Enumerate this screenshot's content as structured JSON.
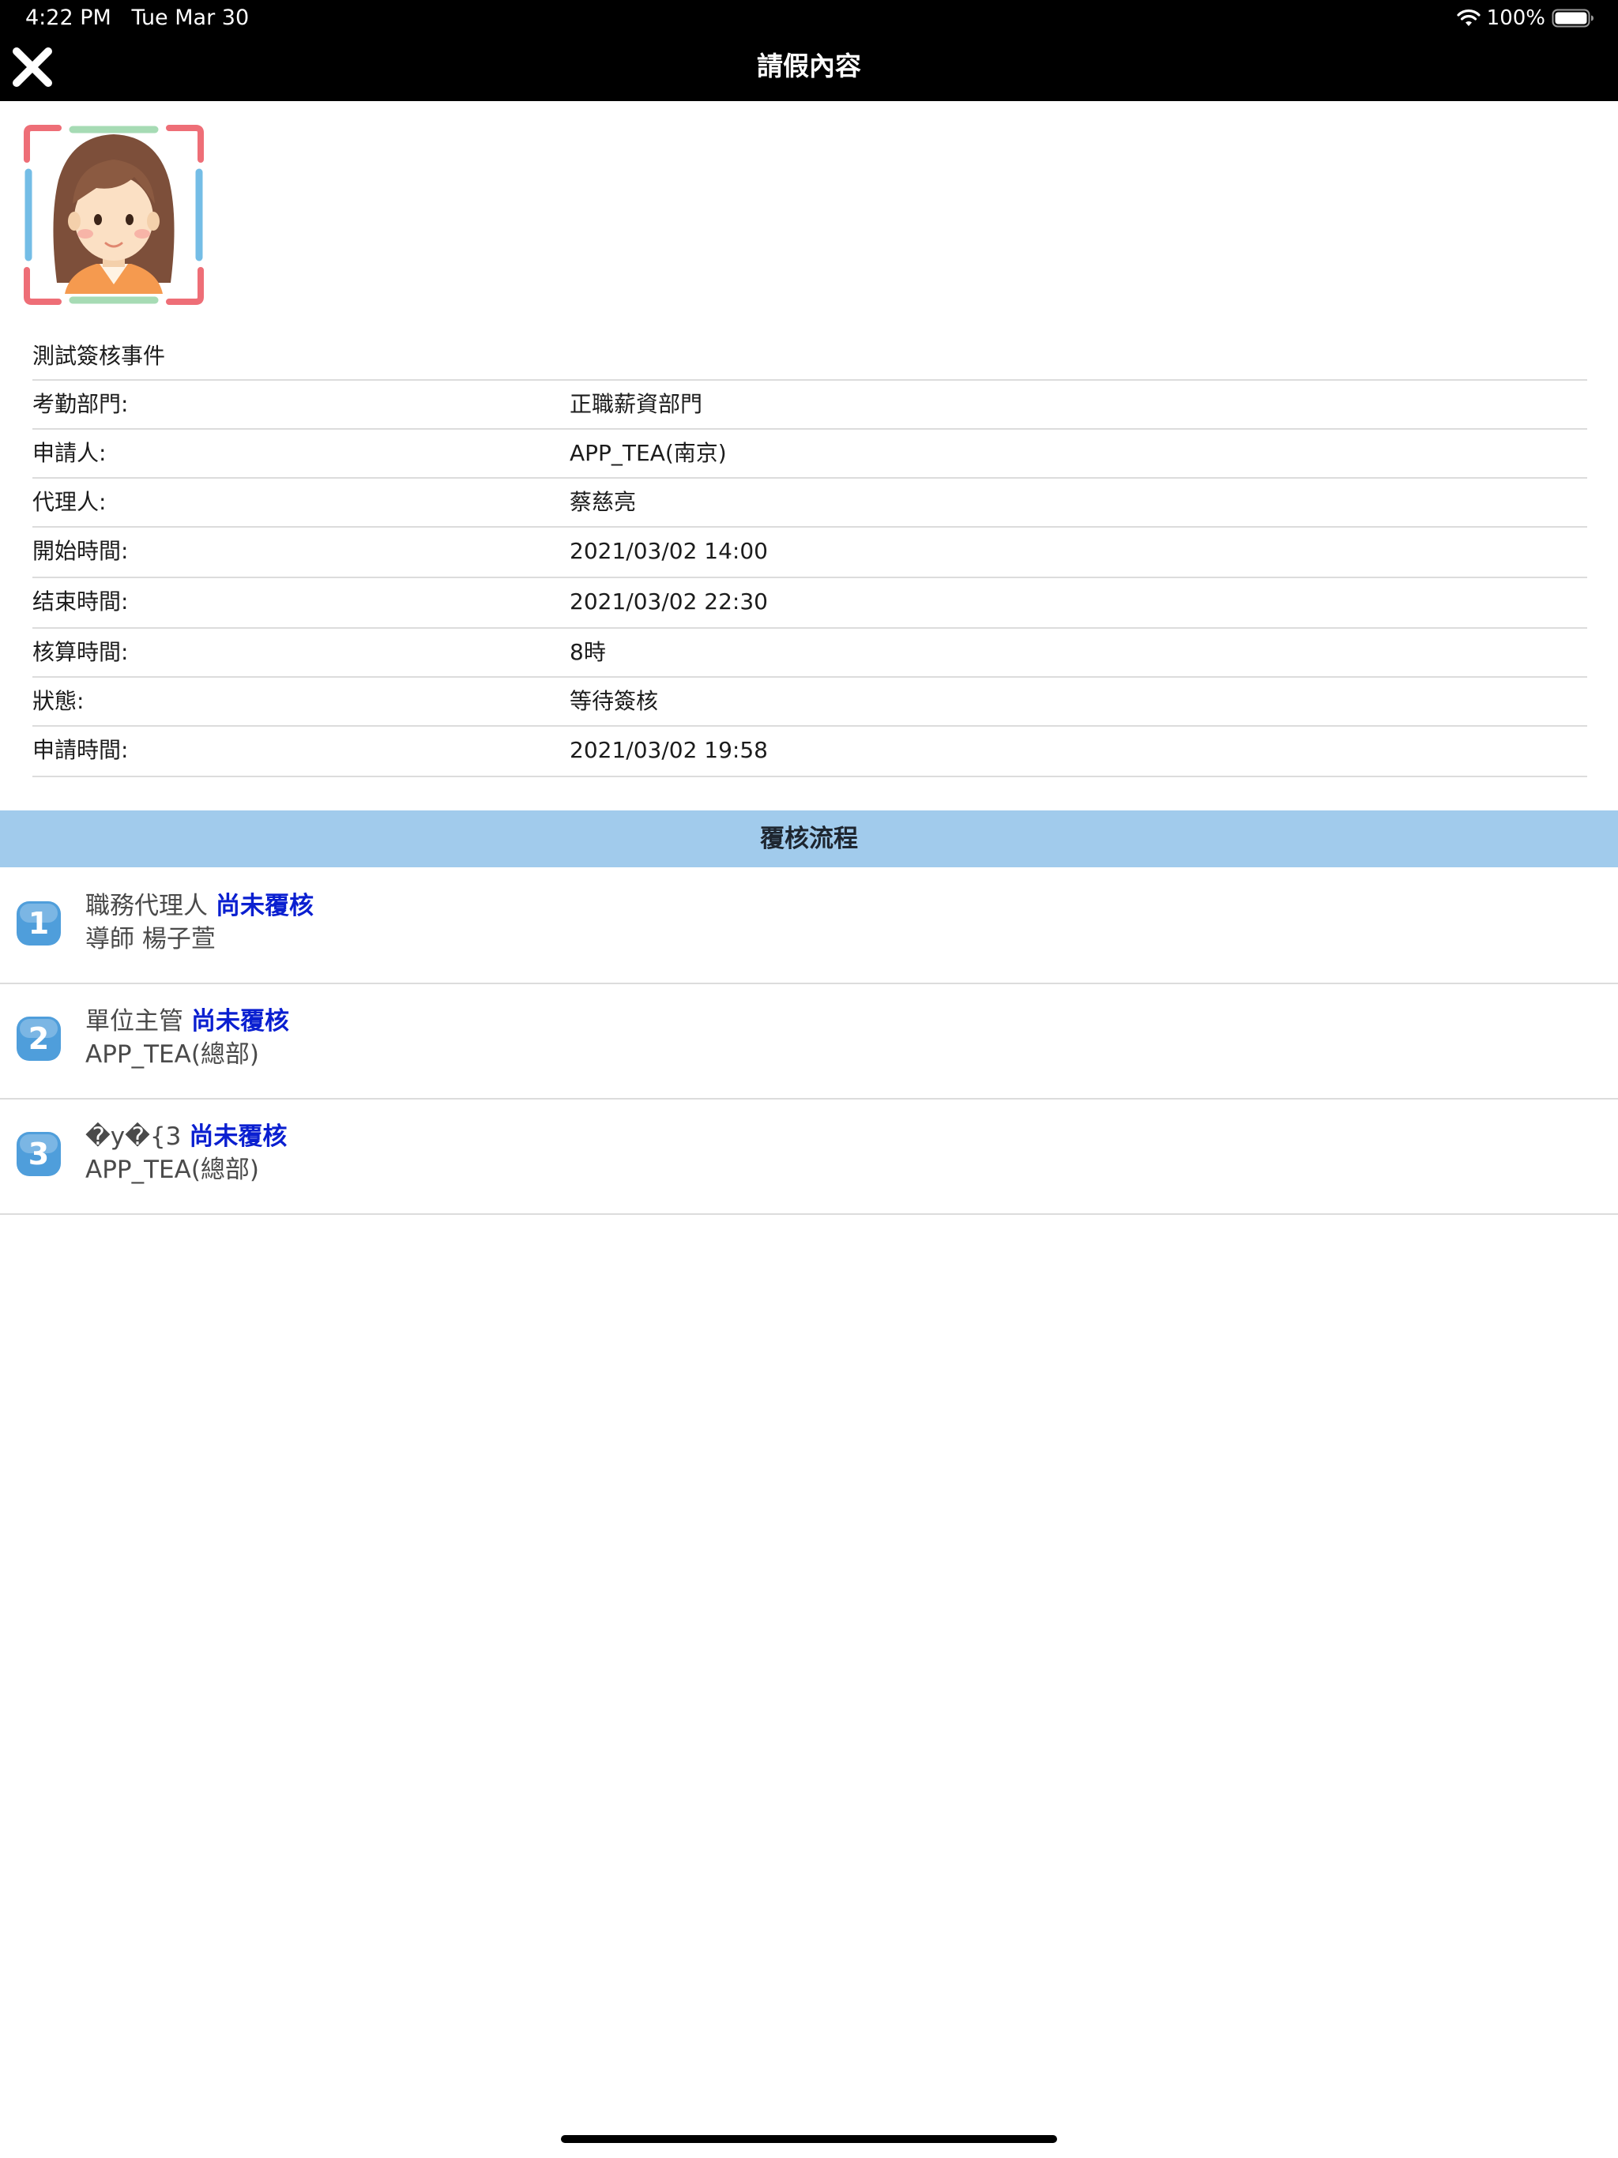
{
  "status_bar": {
    "time": "4:22 PM",
    "date": "Tue Mar 30",
    "battery": "100%"
  },
  "nav": {
    "title": "請假內容",
    "close_icon": "close-icon"
  },
  "detail": {
    "title": "測試簽核事件",
    "rows": [
      {
        "label": "考勤部門:",
        "value": "正職薪資部門"
      },
      {
        "label": "申請人:",
        "value": "APP_TEA(南京)"
      },
      {
        "label": "代理人:",
        "value": "蔡慈亮"
      },
      {
        "label": "開始時間:",
        "value": "2021/03/02 14:00"
      },
      {
        "label": "结束時間:",
        "value": "2021/03/02 22:30"
      },
      {
        "label": "核算時間:",
        "value": "8時"
      },
      {
        "label": "狀態:",
        "value": "等待簽核"
      },
      {
        "label": "申請時間:",
        "value": "2021/03/02 19:58"
      }
    ]
  },
  "flow": {
    "header": "覆核流程",
    "items": [
      {
        "number": "1",
        "role": "職務代理人",
        "status": "尚未覆核",
        "person": "導師 楊子萱"
      },
      {
        "number": "2",
        "role": "單位主管",
        "status": "尚未覆核",
        "person": "APP_TEA(總部)"
      },
      {
        "number": "3",
        "role": "�y�{3",
        "status": "尚未覆核",
        "person": "APP_TEA(總部)"
      }
    ]
  },
  "colors": {
    "flow_header_bg": "#a1cbec",
    "status_text": "#0a1fd0",
    "badge": "#5aa6de"
  }
}
